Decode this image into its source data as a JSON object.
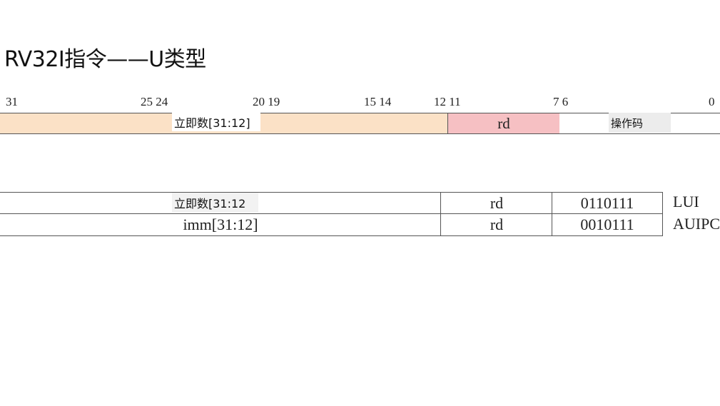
{
  "slide": {
    "title": "RV32I指令——U类型"
  },
  "format": {
    "bit_numbers": [
      "31",
      "25 24",
      "20 19",
      "15 14",
      "12 11",
      "7 6",
      "0"
    ],
    "fields": {
      "imm_label": "立即数[31:12]",
      "rd_label": "rd",
      "opcode_label": "操作码"
    },
    "colors": {
      "imm": "#fbe1c6",
      "rd": "#f6c0c3",
      "opcode": "#ffffff"
    }
  },
  "table": {
    "rows": [
      {
        "imm": "立即数[31:12",
        "rd": "rd",
        "opcode": "0110111",
        "name": "LUI"
      },
      {
        "imm": "imm[31:12]",
        "rd": "rd",
        "opcode": "0010111",
        "name": "AUIPC"
      }
    ]
  }
}
